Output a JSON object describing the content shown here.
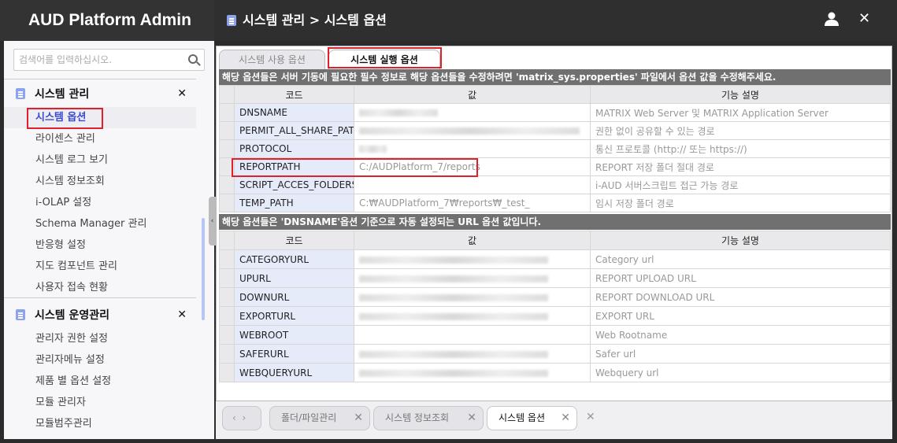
{
  "app": {
    "title": "AUD Platform Admin"
  },
  "header": {
    "breadcrumb": "시스템 관리 > 시스템 옵션"
  },
  "sidebar": {
    "search_placeholder": "검색어를 입력하십시오.",
    "groups": [
      {
        "label": "시스템 관리",
        "items": [
          "시스템 옵션",
          "라이센스 관리",
          "시스템 로그 보기",
          "시스템 정보조회",
          "i-OLAP 설정",
          "Schema Manager 관리",
          "반응형 설정",
          "지도 컴포넌트 관리",
          "사용자 접속 현황"
        ]
      },
      {
        "label": "시스템 운영관리",
        "items": [
          "관리자 권한 설정",
          "관리자메뉴 설정",
          "제품 별 옵션 설정",
          "모듈 관리자",
          "모듈범주관리"
        ]
      }
    ],
    "active_item": "시스템 옵션"
  },
  "tabs": [
    "시스템 사용 옵션",
    "시스템 실행 옵션"
  ],
  "active_tab": "시스템 실행 옵션",
  "section1": {
    "notice": "해당 옵션들은 서버 기동에 필요한 필수 정보로 해당 옵션들을 수정하려면 'matrix_sys.properties' 파일에서 옵션 값을 수정해주세요.",
    "columns": [
      "코드",
      "값",
      "기능 설명"
    ],
    "rows": [
      {
        "code": "DNSNAME",
        "value": "",
        "desc": "MATRIX Web Server 및 MATRIX Application Server"
      },
      {
        "code": "PERMIT_ALL_SHARE_PAT...",
        "value": "",
        "desc": "권한 없이 공유할 수 있는 경로"
      },
      {
        "code": "PROTOCOL",
        "value": "",
        "desc": "통신 프로토콜 (http:// 또는 https://)"
      },
      {
        "code": "REPORTPATH",
        "value": "C:/AUDPlatform_7/reports",
        "desc": "REPORT 저장 폴더 절대 경로"
      },
      {
        "code": "SCRIPT_ACCES_FOLDERS",
        "value": "",
        "desc": "i-AUD 서버스크립트 접근 가능 경로"
      },
      {
        "code": "TEMP_PATH",
        "value": "C:₩AUDPlatform_7₩reports₩_test_",
        "desc": "임시 저장 폴더 경로"
      }
    ]
  },
  "section2": {
    "notice": "해당 옵션들은 'DNSNAME'옵션 기준으로 자동 설정되는 URL 옵션 값입니다.",
    "columns": [
      "코드",
      "값",
      "기능 설명"
    ],
    "rows": [
      {
        "code": "CATEGORYURL",
        "value": "",
        "desc": "Category url"
      },
      {
        "code": "UPURL",
        "value": "",
        "desc": "REPORT UPLOAD URL"
      },
      {
        "code": "DOWNURL",
        "value": "",
        "desc": "REPORT DOWNLOAD URL"
      },
      {
        "code": "EXPORTURL",
        "value": "",
        "desc": "EXPORT URL"
      },
      {
        "code": "WEBROOT",
        "value": "",
        "desc": "Web Rootname"
      },
      {
        "code": "SAFERURL",
        "value": "",
        "desc": "Safer url"
      },
      {
        "code": "WEBQUERYURL",
        "value": "",
        "desc": "Webquery url"
      }
    ]
  },
  "bottom_tabs": [
    "폴더/파일관리",
    "시스템 정보조회",
    "시스템 옵션"
  ],
  "active_bottom_tab": "시스템 옵션"
}
